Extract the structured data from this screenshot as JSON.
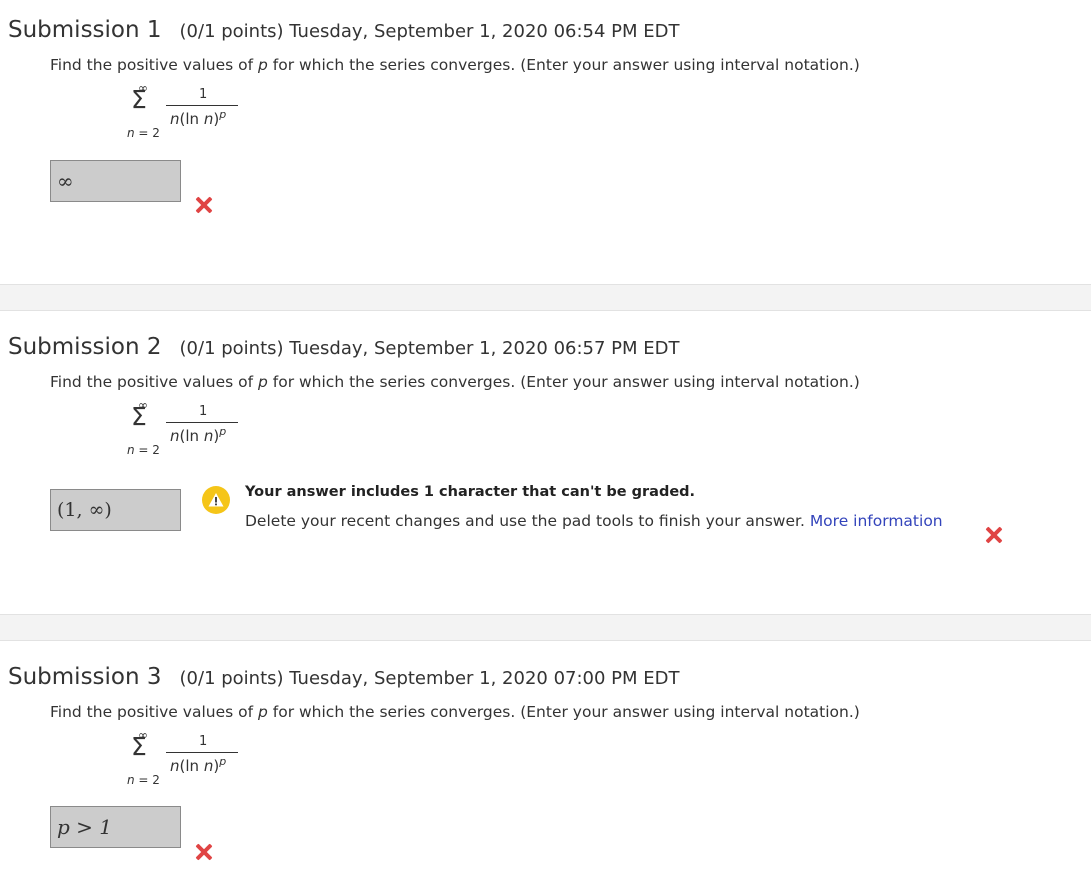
{
  "question": {
    "text_before": "Find the positive values of ",
    "variable": "p",
    "text_after": " for which the series converges. (Enter your answer using interval notation.)",
    "series": {
      "upper": "∞",
      "sigma": "Σ",
      "lower_var": "n",
      "lower_rest": " = 2",
      "numerator": "1",
      "den_n": "n",
      "den_paren": "(ln ",
      "den_n2": "n",
      "den_close": ")",
      "den_exp": "p"
    }
  },
  "submissions": [
    {
      "title": "Submission 1",
      "meta": "(0/1 points)  Tuesday, September 1, 2020 06:54 PM EDT",
      "answer": "∞",
      "status": "incorrect"
    },
    {
      "title": "Submission 2",
      "meta": "(0/1 points)  Tuesday, September 1, 2020 06:57 PM EDT",
      "answer": "(1,  ∞)",
      "status": "incorrect",
      "warning": {
        "title": "Your answer includes 1 character that can't be graded.",
        "body": "Delete your recent changes and use the pad tools to finish your answer. ",
        "link": "More information"
      }
    },
    {
      "title": "Submission 3",
      "meta": "(0/1 points)  Tuesday, September 1, 2020 07:00 PM EDT",
      "answer": "p > 1",
      "status": "incorrect"
    }
  ],
  "colors": {
    "incorrect": "#e04444",
    "warning": "#f5c518",
    "link": "#3344bb"
  }
}
